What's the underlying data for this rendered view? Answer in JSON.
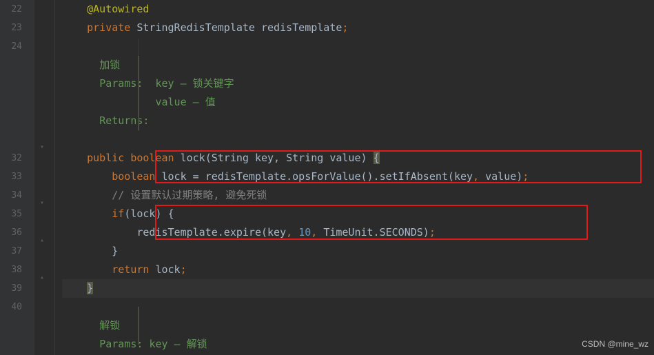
{
  "line_numbers": [
    "22",
    "23",
    "24",
    "",
    "",
    "",
    "",
    "",
    "32",
    "33",
    "34",
    "35",
    "36",
    "37",
    "38",
    "39",
    "40",
    "",
    "",
    ""
  ],
  "code": {
    "l22_annot": "@Autowired",
    "l23_kw": "private",
    "l23_type": " StringRedisTemplate redisTemplate",
    "l23_semi": ";",
    "doc1_title": "加锁",
    "doc1_params_label": "Params:",
    "doc1_p1_name": "key",
    "doc1_p1_desc": "锁关键字",
    "doc1_p2_name": "value",
    "doc1_p2_desc": "值",
    "doc1_returns": "Returns:",
    "l32_pub": "public",
    "l32_bool": " boolean ",
    "l32_name": "lock",
    "l32_sig": "(String key, String value) ",
    "l32_brace": "{",
    "l33_kw": "boolean",
    "l33_rest": " lock = redisTemplate.opsForValue().setIfAbsent(key",
    "l33_comma": ", ",
    "l33_arg2": "value)",
    "l33_semi": ";",
    "l34_comment": "// 设置默认过期策略, 避免死锁",
    "l35_if": "if",
    "l35_cond": "(lock) {",
    "l36_call": "redisTemplate.expire(key",
    "l36_comma": ", ",
    "l36_num": "10",
    "l36_comma2": ", ",
    "l36_rest": "TimeUnit.SECONDS)",
    "l36_semi": ";",
    "l37_close": "}",
    "l38_ret": "return",
    "l38_val": " lock",
    "l38_semi": ";",
    "l39_close": "}",
    "doc2_title": "解锁",
    "doc2_params_label": "Params:",
    "doc2_p1_name": "key",
    "doc2_p1_desc": "解锁",
    "dash": " – "
  },
  "watermark": "CSDN @mine_wz"
}
